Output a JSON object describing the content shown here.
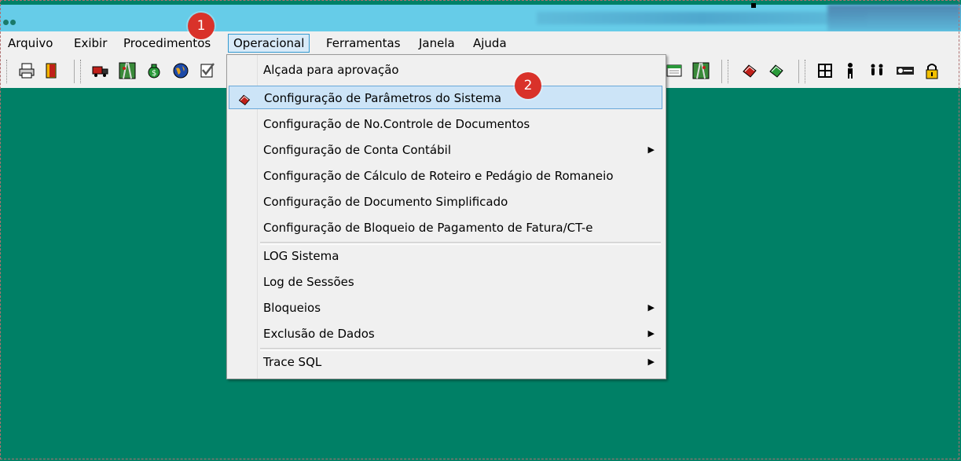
{
  "menubar": {
    "items": [
      {
        "label": "Arquivo"
      },
      {
        "label": "Exibir"
      },
      {
        "label": "Procedimentos"
      },
      {
        "label": "Operacional"
      },
      {
        "label": "Ferramentas"
      },
      {
        "label": "Janela"
      },
      {
        "label": "Ajuda"
      }
    ]
  },
  "badges": {
    "one": "1",
    "two": "2"
  },
  "toolbar": {
    "icons": [
      "print-icon",
      "exit-door-icon",
      "truck-icon",
      "road-map-icon",
      "money-bag-icon",
      "globe-icon",
      "checklist-icon",
      "calendar-icon",
      "road-icon",
      "parameters-icon",
      "parameters-icon-2",
      "network-icon",
      "person-icon",
      "people-icon",
      "key-icon",
      "lock-icon"
    ]
  },
  "dropdown": {
    "items": [
      {
        "label": "Alçada para aprovação",
        "has_submenu": false
      },
      {
        "label": "Configuração de Parâmetros do Sistema",
        "has_submenu": false,
        "highlighted": true
      },
      {
        "label": "Configuração de No.Controle de Documentos",
        "has_submenu": false
      },
      {
        "label": "Configuração de Conta Contábil",
        "has_submenu": true
      },
      {
        "label": "Configuração de Cálculo de Roteiro e Pedágio de Romaneio",
        "has_submenu": false
      },
      {
        "label": "Configuração de Documento Simplificado",
        "has_submenu": false
      },
      {
        "label": "Configuração de Bloqueio de Pagamento de Fatura/CT-e",
        "has_submenu": false
      },
      {
        "label": "LOG Sistema",
        "has_submenu": false
      },
      {
        "label": "Log de Sessões",
        "has_submenu": false
      },
      {
        "label": "Bloqueios",
        "has_submenu": true
      },
      {
        "label": "Exclusão de Dados",
        "has_submenu": true
      },
      {
        "label": "Trace SQL",
        "has_submenu": true
      }
    ],
    "submenu_arrow": "▶"
  },
  "colors": {
    "desktop": "#008066",
    "titlebar": "#66cce8",
    "badge": "#d9322a",
    "highlight": "#cce4f7"
  }
}
